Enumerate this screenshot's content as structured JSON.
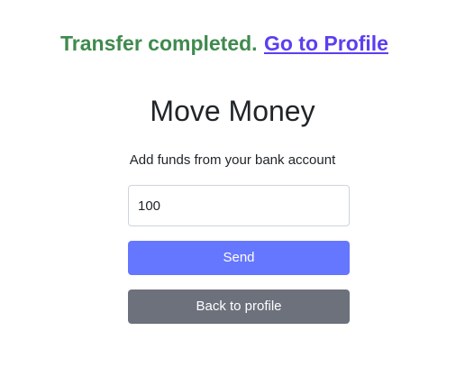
{
  "status": {
    "message": "Transfer completed.",
    "link_label": "Go to Profile"
  },
  "page": {
    "title": "Move Money",
    "subtitle": "Add funds from your bank account"
  },
  "form": {
    "amount_value": "100"
  },
  "buttons": {
    "send_label": "Send",
    "back_label": "Back to profile"
  },
  "colors": {
    "success_text": "#3f8a4e",
    "link": "#5a3ff0",
    "send_button": "#6577ff",
    "back_button": "#6c717c"
  }
}
